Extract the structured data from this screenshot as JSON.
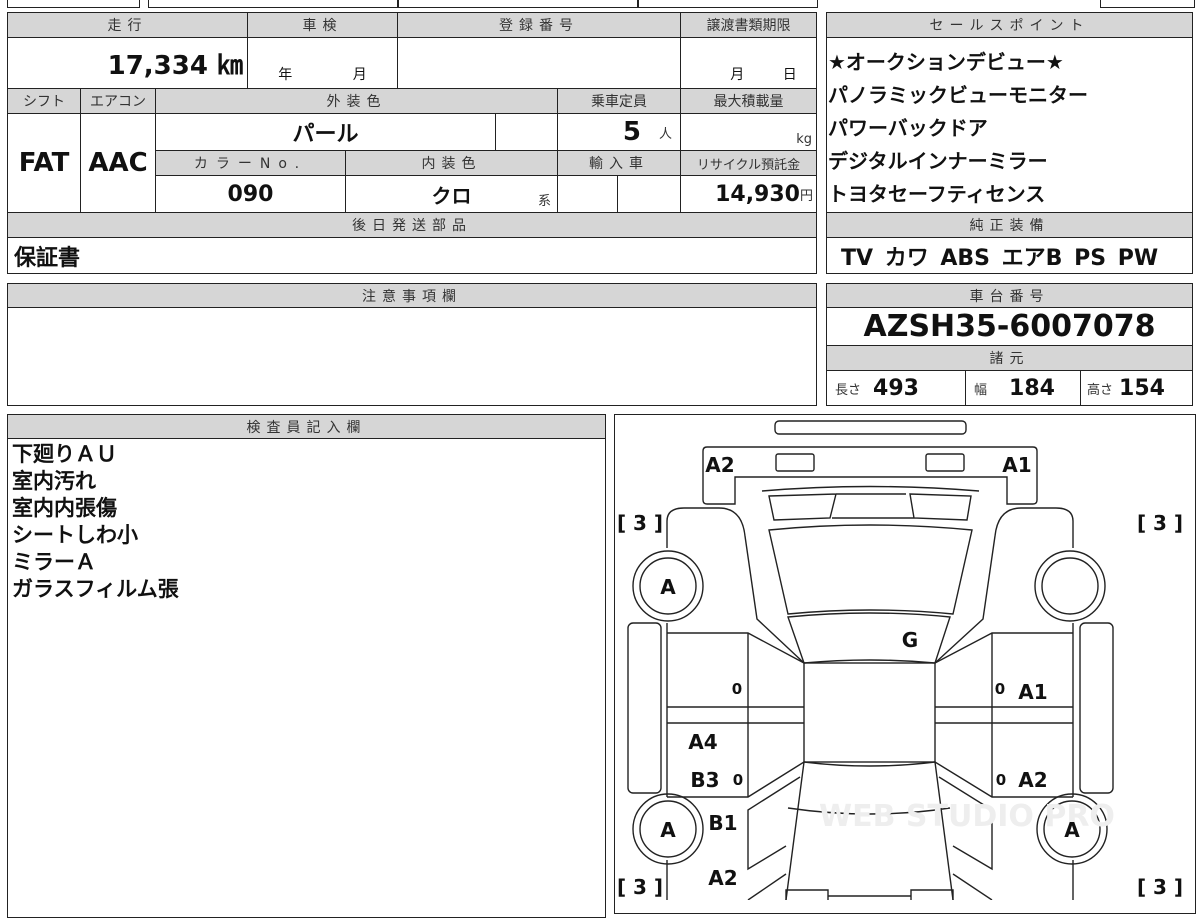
{
  "vehicle_info": {
    "mileage": {
      "label": "走行",
      "value": "17,334 ㎞"
    },
    "inspection": {
      "label": "車検",
      "year_unit": "年",
      "month_unit": "月"
    },
    "registration_number": {
      "label": "登録番号",
      "value": ""
    },
    "transfer_deadline": {
      "label": "譲渡書類期限",
      "month_unit": "月",
      "day_unit": "日"
    },
    "shift": {
      "label": "シフト",
      "value": "FAT"
    },
    "aircon": {
      "label": "エアコン",
      "value": "AAC"
    },
    "exterior_color": {
      "label": "外装色",
      "value": "パール"
    },
    "capacity": {
      "label": "乗車定員",
      "value": "5",
      "unit": "人"
    },
    "max_load": {
      "label": "最大積載量",
      "unit": "kg"
    },
    "color_no": {
      "label": "カラーNo.",
      "value": "090"
    },
    "interior_color": {
      "label": "内装色",
      "value": "クロ",
      "unit": "系"
    },
    "imported": {
      "label": "輸入車"
    },
    "recycle_fee": {
      "label": "リサイクル預託金",
      "value": "14,930",
      "unit": "円"
    },
    "later_parts": {
      "label": "後日発送部品",
      "value": "保証書"
    }
  },
  "notes": {
    "label": "注意事項欄"
  },
  "sales_points": {
    "label": "セールスポイント",
    "items": [
      "★オークションデビュー★",
      "パノラミックビューモニター",
      "パワーバックドア",
      "デジタルインナーミラー",
      "トヨタセーフティセンス"
    ]
  },
  "equipment": {
    "label": "純正装備",
    "value": "TV カワ ABS エアB PS PW"
  },
  "chassis": {
    "label": "車台番号",
    "value": "AZSH35-6007078"
  },
  "specs": {
    "label": "諸元",
    "length": {
      "label": "長さ",
      "value": "493"
    },
    "width": {
      "label": "幅",
      "value": "184"
    },
    "height": {
      "label": "高さ",
      "value": "154"
    }
  },
  "inspector": {
    "label": "検査員記入欄",
    "lines": [
      "下廻りＡＵ",
      "室内汚れ",
      "室内内張傷",
      "シートしわ小",
      "ミラーＡ",
      "ガラスフィルム張"
    ]
  },
  "diagram": {
    "marks": [
      "A2",
      "A1",
      "[ 3 ]",
      "[ 3 ]",
      "[ 3 ]",
      "[ 3 ]",
      "A",
      "A",
      "A",
      "G",
      "0",
      "A1",
      "A4",
      "B3",
      "0",
      "0",
      "A2",
      "B1",
      "A2",
      "0"
    ],
    "watermark": "WEB STUDIO PRO"
  }
}
